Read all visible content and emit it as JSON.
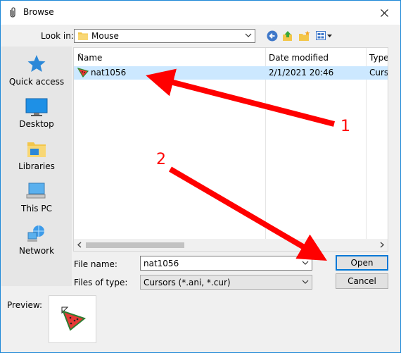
{
  "title": "Browse",
  "look_in": {
    "label": "Look in:",
    "value": "Mouse"
  },
  "places": [
    {
      "label": "Quick access",
      "icon": "star-icon"
    },
    {
      "label": "Desktop",
      "icon": "desktop-icon"
    },
    {
      "label": "Libraries",
      "icon": "libraries-icon"
    },
    {
      "label": "This PC",
      "icon": "computer-icon"
    },
    {
      "label": "Network",
      "icon": "network-icon"
    }
  ],
  "columns": [
    "Name",
    "Date modified",
    "Type"
  ],
  "files": [
    {
      "name": "nat1056",
      "date": "2/1/2021 20:46",
      "type": "Cursors"
    }
  ],
  "file_name": {
    "label": "File name:",
    "value": "nat1056"
  },
  "file_type": {
    "label": "Files of type:",
    "value": "Cursors (*.ani, *.cur)"
  },
  "buttons": {
    "open": "Open",
    "cancel": "Cancel"
  },
  "preview_label": "Preview:",
  "annotations": {
    "one": "1",
    "two": "2"
  },
  "colors": {
    "accent": "#0078d7",
    "selection": "#cce8ff",
    "annotation": "#ff0000"
  }
}
